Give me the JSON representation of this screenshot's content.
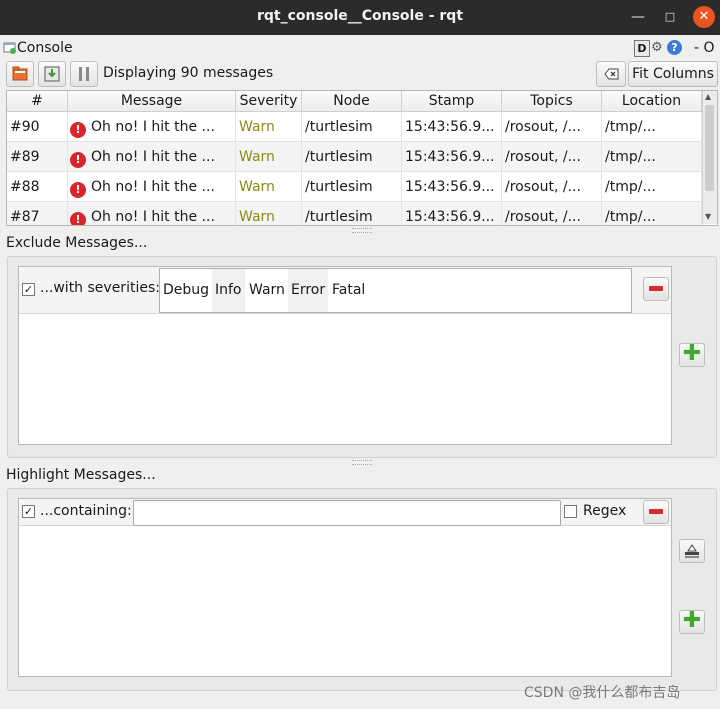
{
  "window": {
    "title": "rqt_console__Console - rqt",
    "minimize": "—",
    "maximize": "□",
    "close": "✕"
  },
  "plugin": {
    "title": "Console",
    "help_d": "D",
    "help_q": "?",
    "dash_o": "- O"
  },
  "toolbar": {
    "display_count": "Displaying 90 messages",
    "fit_columns": "Fit Columns"
  },
  "table": {
    "columns": [
      "#",
      "Message",
      "Severity",
      "Node",
      "Stamp",
      "Topics",
      "Location"
    ],
    "rows": [
      {
        "id": "#90",
        "message": "Oh no! I hit the ...",
        "severity": "Warn",
        "node": "/turtlesim",
        "stamp": "15:43:56.9...",
        "topics": "/rosout, /...",
        "location": "/tmp/..."
      },
      {
        "id": "#89",
        "message": "Oh no! I hit the ...",
        "severity": "Warn",
        "node": "/turtlesim",
        "stamp": "15:43:56.9...",
        "topics": "/rosout, /...",
        "location": "/tmp/..."
      },
      {
        "id": "#88",
        "message": "Oh no! I hit the ...",
        "severity": "Warn",
        "node": "/turtlesim",
        "stamp": "15:43:56.9...",
        "topics": "/rosout, /...",
        "location": "/tmp/..."
      },
      {
        "id": "#87",
        "message": "Oh no! I hit the ...",
        "severity": "Warn",
        "node": "/turtlesim",
        "stamp": "15:43:56.9...",
        "topics": "/rosout, /...",
        "location": "/tmp/..."
      }
    ]
  },
  "exclude": {
    "title": "Exclude Messages...",
    "filter_label": "...with severities:",
    "checked": "✓",
    "severities": [
      "Debug",
      "Info",
      "Warn",
      "Error",
      "Fatal"
    ]
  },
  "highlight": {
    "title": "Highlight Messages...",
    "filter_label": "...containing:",
    "checked": "✓",
    "input_value": "",
    "regex_label": "Regex"
  },
  "watermark": "CSDN @我什么都布吉岛",
  "colors": {
    "titlebar": "#2b2b2b",
    "close_button": "#e95420",
    "warn_text": "#8a8a15",
    "error_icon": "#d8262d",
    "remove_icon": "#d42b2b",
    "add_icon": "#3faa2b"
  },
  "icons": [
    "open-folder-icon",
    "save-icon",
    "pause-icon",
    "clear-icon",
    "error-icon",
    "remove-icon",
    "add-icon",
    "highlight-icon",
    "gear-icon",
    "help-icon"
  ]
}
